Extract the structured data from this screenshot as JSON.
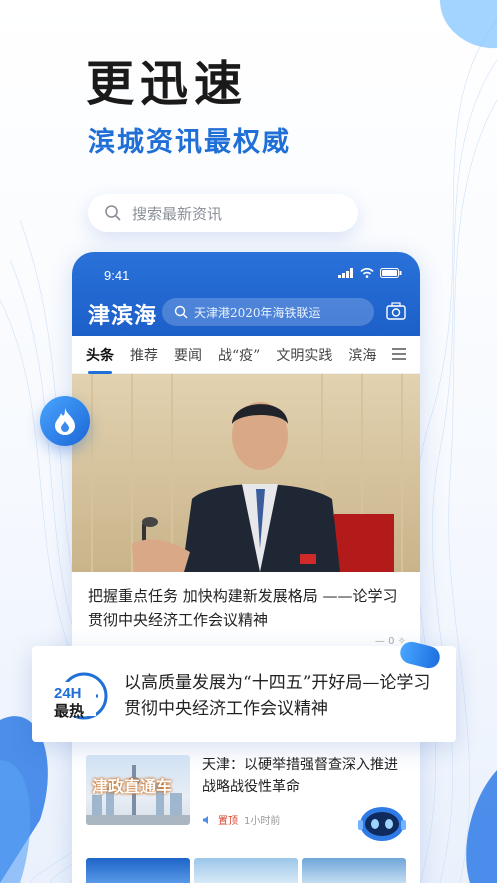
{
  "hero": {
    "title": "更迅速",
    "subtitle": "滨城资讯最权威"
  },
  "outer_search": {
    "placeholder": "搜索最新资讯"
  },
  "phone": {
    "status_time": "9:41",
    "logo": "津滨海",
    "search_text": "天津港2020年海铁联运",
    "tabs": [
      {
        "label": "头条",
        "active": true
      },
      {
        "label": "推荐"
      },
      {
        "label": "要闻"
      },
      {
        "label": "战“疫”"
      },
      {
        "label": "文明实践"
      },
      {
        "label": "滨海"
      }
    ],
    "news1": {
      "title": "把握重点任务 加快构建新发展格局 ——论学习贯彻中央经济工作会议精神",
      "meta": "0"
    },
    "news2": {
      "thumb_label": "津政直通车",
      "title": "天津：以硬举措强督查深入推进战略战役性革命",
      "source": "置顶",
      "time": "1小时前"
    }
  },
  "hot_card": {
    "badge_top": "24H",
    "badge_bottom": "最热",
    "text": "以高质量发展为“十四五”开好局—论学习贯彻中央经济工作会议精神"
  },
  "colors": {
    "accent": "#1f6fd6",
    "header": "#2a71da"
  }
}
